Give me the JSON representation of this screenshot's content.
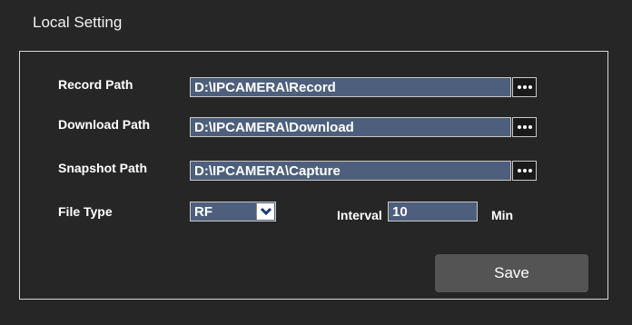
{
  "panel": {
    "title": "Local Setting"
  },
  "record_path": {
    "label": "Record Path",
    "value": "D:\\IPCAMERA\\Record"
  },
  "download_path": {
    "label": "Download Path",
    "value": "D:\\IPCAMERA\\Download"
  },
  "snapshot_path": {
    "label": "Snapshot Path",
    "value": "D:\\IPCAMERA\\Capture"
  },
  "file_type": {
    "label": "File Type",
    "selected": "RF"
  },
  "interval": {
    "label": "Interval",
    "value": "10",
    "unit": "Min"
  },
  "actions": {
    "save_label": "Save"
  },
  "icons": {
    "browse": "ellipsis-icon",
    "dropdown": "chevron-down-icon"
  },
  "colors": {
    "background": "#262626",
    "field": "#4d5f7c",
    "button": "#545454"
  }
}
